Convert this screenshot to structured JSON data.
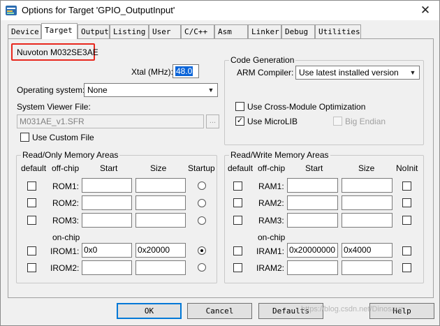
{
  "window": {
    "title": "Options for Target 'GPIO_OutputInput'",
    "close_glyph": "✕"
  },
  "tabs": [
    {
      "label": "Device"
    },
    {
      "label": "Target"
    },
    {
      "label": "Output"
    },
    {
      "label": "Listing"
    },
    {
      "label": "User"
    },
    {
      "label": "C/C++"
    },
    {
      "label": "Asm"
    },
    {
      "label": "Linker"
    },
    {
      "label": "Debug"
    },
    {
      "label": "Utilities"
    }
  ],
  "active_tab": "Target",
  "device_name": "Nuvoton M032SE3AE",
  "xtal": {
    "label": "Xtal (MHz):",
    "value": "48.0"
  },
  "os": {
    "label": "Operating system:",
    "value": "None"
  },
  "svf": {
    "label": "System Viewer File:",
    "value": "M031AE_v1.SFR",
    "browse": "..."
  },
  "custom_file": {
    "label": "Use Custom File",
    "checked": false
  },
  "code_gen": {
    "title": "Code Generation",
    "compiler_label": "ARM Compiler:",
    "compiler_value": "Use latest installed version",
    "cross_module": {
      "label": "Use Cross-Module Optimization",
      "checked": false
    },
    "microlib": {
      "label": "Use MicroLIB",
      "checked": true
    },
    "big_endian": {
      "label": "Big Endian",
      "checked": false,
      "enabled": false
    }
  },
  "ro": {
    "title": "Read/Only Memory Areas",
    "headers": {
      "default": "default",
      "offchip": "off-chip",
      "start": "Start",
      "size": "Size",
      "startup": "Startup"
    },
    "onchip_label": "on-chip",
    "rows": [
      {
        "name": "ROM1:",
        "start": "",
        "size": ""
      },
      {
        "name": "ROM2:",
        "start": "",
        "size": ""
      },
      {
        "name": "ROM3:",
        "start": "",
        "size": ""
      },
      {
        "name": "IROM1:",
        "start": "0x0",
        "size": "0x20000"
      },
      {
        "name": "IROM2:",
        "start": "",
        "size": ""
      }
    ]
  },
  "rw": {
    "title": "Read/Write Memory Areas",
    "headers": {
      "default": "default",
      "offchip": "off-chip",
      "start": "Start",
      "size": "Size",
      "noinit": "NoInit"
    },
    "onchip_label": "on-chip",
    "rows": [
      {
        "name": "RAM1:",
        "start": "",
        "size": ""
      },
      {
        "name": "RAM2:",
        "start": "",
        "size": ""
      },
      {
        "name": "RAM3:",
        "start": "",
        "size": ""
      },
      {
        "name": "IRAM1:",
        "start": "0x20000000",
        "size": "0x4000"
      },
      {
        "name": "IRAM2:",
        "start": "",
        "size": ""
      }
    ]
  },
  "buttons": {
    "ok": "OK",
    "cancel": "Cancel",
    "defaults": "Defaults",
    "help": "Help"
  },
  "watermark": "https://blog.csdn.net/Dinosaur"
}
